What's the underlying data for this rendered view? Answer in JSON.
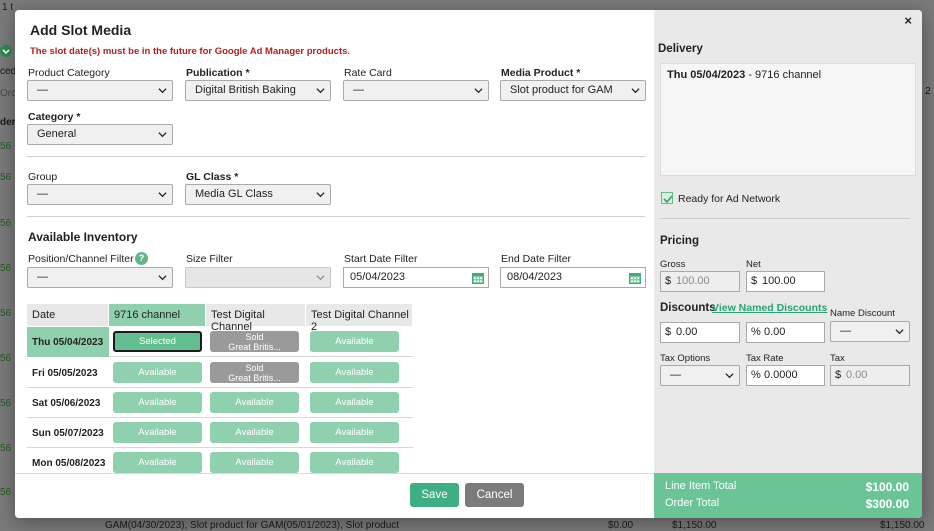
{
  "background": {
    "row_count_label": "1 t",
    "ced_fragment": "ced",
    "ord_fragment": "Ord",
    "der_fragment": "der",
    "links": [
      "56",
      "56",
      "56",
      "56",
      "56",
      "56",
      "56",
      "56",
      "56"
    ],
    "bottom_row": "GAM(04/30/2023), Slot product for GAM(05/01/2023), Slot product",
    "right_num": "2",
    "bottom_amounts": [
      "$0.00",
      "$1,150.00",
      "$1,150.00"
    ]
  },
  "modal": {
    "title": "Add Slot Media",
    "warning": "The slot date(s) must be in the future for Google Ad Manager products.",
    "fields": {
      "product_category": {
        "label": "Product Category",
        "value": "—"
      },
      "publication": {
        "label": "Publication *",
        "value": "Digital British Baking"
      },
      "rate_card": {
        "label": "Rate Card",
        "value": "—"
      },
      "media_product": {
        "label": "Media Product *",
        "value": "Slot product for GAM"
      },
      "category": {
        "label": "Category *",
        "value": "General"
      },
      "group": {
        "label": "Group",
        "value": "—"
      },
      "gl_class": {
        "label": "GL Class *",
        "value": "Media GL Class"
      }
    },
    "inventory": {
      "heading": "Available Inventory",
      "position_filter": {
        "label": "Position/Channel Filter",
        "value": "—"
      },
      "size_filter": {
        "label": "Size Filter",
        "value": ""
      },
      "start_date": {
        "label": "Start Date Filter",
        "value": "05/04/2023"
      },
      "end_date": {
        "label": "End Date Filter",
        "value": "08/04/2023"
      },
      "columns": [
        "Date",
        "9716 channel",
        "Test Digital Channel",
        "Test Digital Channel 2"
      ],
      "rows": [
        {
          "date": "Thu 05/04/2023",
          "cells": [
            {
              "status": "selected",
              "text": "Selected"
            },
            {
              "status": "sold",
              "text": "Sold",
              "sub": "Great Britis..."
            },
            {
              "status": "available",
              "text": "Available"
            }
          ]
        },
        {
          "date": "Fri 05/05/2023",
          "cells": [
            {
              "status": "available",
              "text": "Available"
            },
            {
              "status": "sold",
              "text": "Sold",
              "sub": "Great Britis..."
            },
            {
              "status": "available",
              "text": "Available"
            }
          ]
        },
        {
          "date": "Sat 05/06/2023",
          "cells": [
            {
              "status": "available",
              "text": "Available"
            },
            {
              "status": "available",
              "text": "Available"
            },
            {
              "status": "available",
              "text": "Available"
            }
          ]
        },
        {
          "date": "Sun 05/07/2023",
          "cells": [
            {
              "status": "available",
              "text": "Available"
            },
            {
              "status": "available",
              "text": "Available"
            },
            {
              "status": "available",
              "text": "Available"
            }
          ]
        },
        {
          "date": "Mon 05/08/2023",
          "cells": [
            {
              "status": "available",
              "text": "Available"
            },
            {
              "status": "available",
              "text": "Available"
            },
            {
              "status": "available",
              "text": "Available"
            }
          ]
        }
      ]
    },
    "buttons": {
      "save": "Save",
      "cancel": "Cancel"
    }
  },
  "sidebar": {
    "close": "×",
    "delivery_heading": "Delivery",
    "delivery_date": "Thu 05/04/2023",
    "delivery_rest": " - 9716 channel",
    "ready_label": "Ready for Ad Network",
    "pricing_heading": "Pricing",
    "gross": {
      "label": "Gross",
      "prefix": "$",
      "value": "100.00"
    },
    "net": {
      "label": "Net",
      "prefix": "$",
      "value": "100.00"
    },
    "discounts_heading": "Discounts",
    "view_named_discounts": "View Named Discounts",
    "discount_amount": {
      "prefix": "$",
      "value": "0.00"
    },
    "discount_percent": {
      "prefix": "%",
      "value": "0.00"
    },
    "name_discount": {
      "label": "Name Discount",
      "value": "—"
    },
    "tax_options": {
      "label": "Tax Options",
      "value": "—"
    },
    "tax_rate": {
      "label": "Tax Rate",
      "prefix": "%",
      "value": "0.0000"
    },
    "tax": {
      "label": "Tax",
      "prefix": "$",
      "value": "0.00"
    },
    "line_item_total": {
      "label": "Line Item Total",
      "value": "$100.00"
    },
    "order_total": {
      "label": "Order Total",
      "value": "$300.00"
    }
  },
  "colors": {
    "accent": "#3fae82",
    "selected_fill": "#63bf8f",
    "available_fill": "#8fd1ae",
    "sold_fill": "#9a9a9a",
    "warning": "#b22020"
  }
}
